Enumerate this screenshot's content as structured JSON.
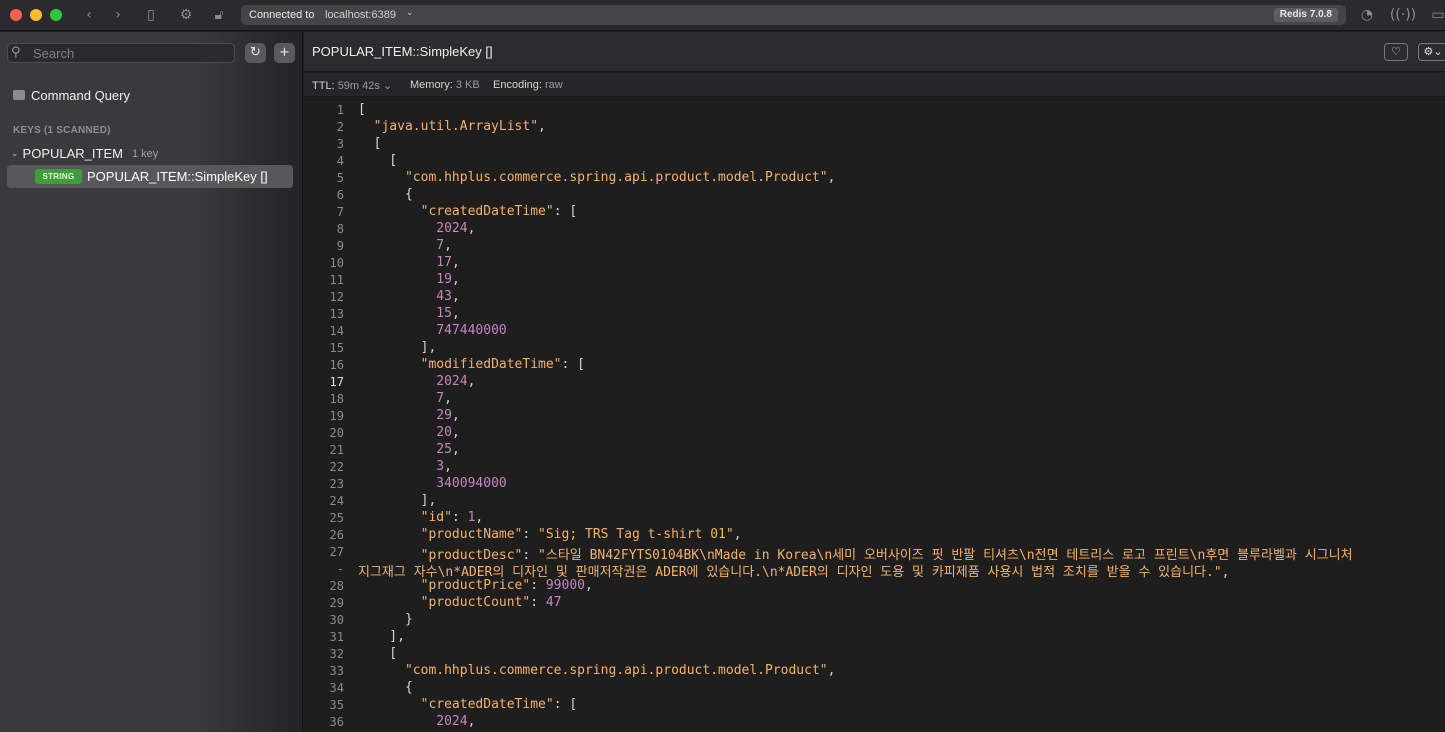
{
  "titlebar": {
    "connection_label": "Connected to",
    "host": "localhost:6389",
    "version": "Redis 7.0.8",
    "icons": [
      "chevron-left-icon",
      "chevron-right-icon",
      "sidebar-toggle-icon",
      "gear-icon",
      "unlock-icon",
      "clock-icon",
      "broadcast-icon",
      "split-view-icon"
    ]
  },
  "sidebar": {
    "search": {
      "placeholder": "Search",
      "value": ""
    },
    "refresh_icon": "↻",
    "add_icon": "+",
    "command_query": "Command Query",
    "keys_header": "KEYS (1 SCANNED)",
    "group": {
      "label": "POPULAR_ITEM",
      "count": "1 key"
    },
    "key": {
      "type": "STRING",
      "label": "POPULAR_ITEM::SimpleKey []"
    }
  },
  "main": {
    "key_title": "POPULAR_ITEM::SimpleKey []",
    "meta": {
      "ttl_label": "TTL:",
      "ttl_value": "59m 42s",
      "memory_label": "Memory:",
      "memory_value": "3 KB",
      "encoding_label": "Encoding:",
      "encoding_value": "raw"
    },
    "current_line": "17",
    "lines": [
      {
        "n": "1",
        "t": [
          [
            "p",
            "["
          ]
        ]
      },
      {
        "n": "2",
        "t": [
          [
            "p",
            "  "
          ],
          [
            "s",
            "\"java.util.ArrayList\""
          ],
          [
            "p",
            ","
          ]
        ]
      },
      {
        "n": "3",
        "t": [
          [
            "p",
            "  ["
          ]
        ]
      },
      {
        "n": "4",
        "t": [
          [
            "p",
            "    ["
          ]
        ]
      },
      {
        "n": "5",
        "t": [
          [
            "p",
            "      "
          ],
          [
            "s",
            "\"com.hhplus.commerce.spring.api.product.model.Product\""
          ],
          [
            "p",
            ","
          ]
        ]
      },
      {
        "n": "6",
        "t": [
          [
            "p",
            "      {"
          ]
        ]
      },
      {
        "n": "7",
        "t": [
          [
            "p",
            "        "
          ],
          [
            "k",
            "\"createdDateTime\""
          ],
          [
            "p",
            ": ["
          ]
        ]
      },
      {
        "n": "8",
        "t": [
          [
            "p",
            "          "
          ],
          [
            "n",
            "2024"
          ],
          [
            "p",
            ","
          ]
        ]
      },
      {
        "n": "9",
        "t": [
          [
            "p",
            "          "
          ],
          [
            "n",
            "7"
          ],
          [
            "p",
            ","
          ]
        ]
      },
      {
        "n": "10",
        "t": [
          [
            "p",
            "          "
          ],
          [
            "n",
            "17"
          ],
          [
            "p",
            ","
          ]
        ]
      },
      {
        "n": "11",
        "t": [
          [
            "p",
            "          "
          ],
          [
            "n",
            "19"
          ],
          [
            "p",
            ","
          ]
        ]
      },
      {
        "n": "12",
        "t": [
          [
            "p",
            "          "
          ],
          [
            "n",
            "43"
          ],
          [
            "p",
            ","
          ]
        ]
      },
      {
        "n": "13",
        "t": [
          [
            "p",
            "          "
          ],
          [
            "n",
            "15"
          ],
          [
            "p",
            ","
          ]
        ]
      },
      {
        "n": "14",
        "t": [
          [
            "p",
            "          "
          ],
          [
            "n",
            "747440000"
          ]
        ]
      },
      {
        "n": "15",
        "t": [
          [
            "p",
            "        ],"
          ]
        ]
      },
      {
        "n": "16",
        "t": [
          [
            "p",
            "        "
          ],
          [
            "k",
            "\"modifiedDateTime\""
          ],
          [
            "p",
            ": ["
          ]
        ]
      },
      {
        "n": "17",
        "t": [
          [
            "p",
            "          "
          ],
          [
            "n",
            "2024"
          ],
          [
            "p",
            ","
          ]
        ]
      },
      {
        "n": "18",
        "t": [
          [
            "p",
            "          "
          ],
          [
            "n",
            "7"
          ],
          [
            "p",
            ","
          ]
        ]
      },
      {
        "n": "19",
        "t": [
          [
            "p",
            "          "
          ],
          [
            "n",
            "29"
          ],
          [
            "p",
            ","
          ]
        ]
      },
      {
        "n": "20",
        "t": [
          [
            "p",
            "          "
          ],
          [
            "n",
            "20"
          ],
          [
            "p",
            ","
          ]
        ]
      },
      {
        "n": "21",
        "t": [
          [
            "p",
            "          "
          ],
          [
            "n",
            "25"
          ],
          [
            "p",
            ","
          ]
        ]
      },
      {
        "n": "22",
        "t": [
          [
            "p",
            "          "
          ],
          [
            "n",
            "3"
          ],
          [
            "p",
            ","
          ]
        ]
      },
      {
        "n": "23",
        "t": [
          [
            "p",
            "          "
          ],
          [
            "n",
            "340094000"
          ]
        ]
      },
      {
        "n": "24",
        "t": [
          [
            "p",
            "        ],"
          ]
        ]
      },
      {
        "n": "25",
        "t": [
          [
            "p",
            "        "
          ],
          [
            "k",
            "\"id\""
          ],
          [
            "p",
            ": "
          ],
          [
            "n",
            "1"
          ],
          [
            "p",
            ","
          ]
        ]
      },
      {
        "n": "26",
        "t": [
          [
            "p",
            "        "
          ],
          [
            "k",
            "\"productName\""
          ],
          [
            "p",
            ": "
          ],
          [
            "s",
            "\"Sig; TRS Tag t-shirt 01\""
          ],
          [
            "p",
            ","
          ]
        ]
      },
      {
        "n": "27",
        "t": [
          [
            "p",
            "        "
          ],
          [
            "k",
            "\"productDesc\""
          ],
          [
            "p",
            ": "
          ],
          [
            "s",
            "\"스타일 BN42FYTS0104BK\\nMade in Korea\\n세미 오버사이즈 핏 반팔 티셔츠\\n전면 테트리스 로고 프린트\\n후면 블루라벨과 시그니처"
          ]
        ]
      },
      {
        "n": "-",
        "t": [
          [
            "s",
            "지그재그 자수\\n*ADER의 디자인 및 판매저작권은 ADER에 있습니다.\\n*ADER의 디자인 도용 및 카피제품 사용시 법적 조치를 받을 수 있습니다.\""
          ],
          [
            "p",
            ","
          ]
        ]
      },
      {
        "n": "28",
        "t": [
          [
            "p",
            "        "
          ],
          [
            "k",
            "\"productPrice\""
          ],
          [
            "p",
            ": "
          ],
          [
            "n",
            "99000"
          ],
          [
            "p",
            ","
          ]
        ]
      },
      {
        "n": "29",
        "t": [
          [
            "p",
            "        "
          ],
          [
            "k",
            "\"productCount\""
          ],
          [
            "p",
            ": "
          ],
          [
            "n",
            "47"
          ]
        ]
      },
      {
        "n": "30",
        "t": [
          [
            "p",
            "      }"
          ]
        ]
      },
      {
        "n": "31",
        "t": [
          [
            "p",
            "    ],"
          ]
        ]
      },
      {
        "n": "32",
        "t": [
          [
            "p",
            "    ["
          ]
        ]
      },
      {
        "n": "33",
        "t": [
          [
            "p",
            "      "
          ],
          [
            "s",
            "\"com.hhplus.commerce.spring.api.product.model.Product\""
          ],
          [
            "p",
            ","
          ]
        ]
      },
      {
        "n": "34",
        "t": [
          [
            "p",
            "      {"
          ]
        ]
      },
      {
        "n": "35",
        "t": [
          [
            "p",
            "        "
          ],
          [
            "k",
            "\"createdDateTime\""
          ],
          [
            "p",
            ": ["
          ]
        ]
      },
      {
        "n": "36",
        "t": [
          [
            "p",
            "          "
          ],
          [
            "n",
            "2024"
          ],
          [
            "p",
            ","
          ]
        ]
      }
    ]
  }
}
